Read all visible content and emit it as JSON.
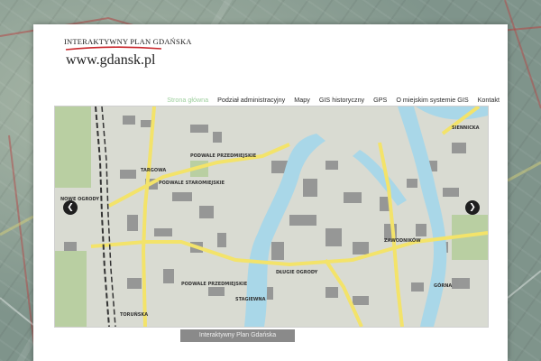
{
  "logo": {
    "top_text": "INTERAKTYWNY PLAN GDAŃSKA",
    "url_text": "www.gdansk.pl"
  },
  "nav": {
    "items": [
      {
        "label": "Strona główna",
        "active": true
      },
      {
        "label": "Podział administracyjny",
        "active": false
      },
      {
        "label": "Mapy",
        "active": false
      },
      {
        "label": "GIS historyczny",
        "active": false
      },
      {
        "label": "GPS",
        "active": false
      },
      {
        "label": "O miejskim systemie GIS",
        "active": false
      },
      {
        "label": "Kontakt",
        "active": false
      }
    ]
  },
  "slider": {
    "prev_icon": "chevron-left-icon",
    "next_icon": "chevron-right-icon",
    "prev_glyph": "❮",
    "next_glyph": "❯",
    "map_labels": [
      "TARGOWA",
      "PODWALE PRZEDMIEJSKIE",
      "PODWALE STAROMIEJSKIE",
      "STAGIEWNA",
      "DŁUGIE OGRODY",
      "PODWALE PRZEDMIEJSKIE",
      "ZAWODNIKÓW",
      "SIENNICKA",
      "TORUŃSKA",
      "NOWE OGRODY",
      "GÓRNA"
    ]
  },
  "caption": {
    "text": "Interaktywny Plan Gdańska"
  },
  "colors": {
    "nav_active": "#9ecf9e",
    "water": "#a9d7e8",
    "major_road": "#f3e36a",
    "rail": "#c33a3a"
  }
}
